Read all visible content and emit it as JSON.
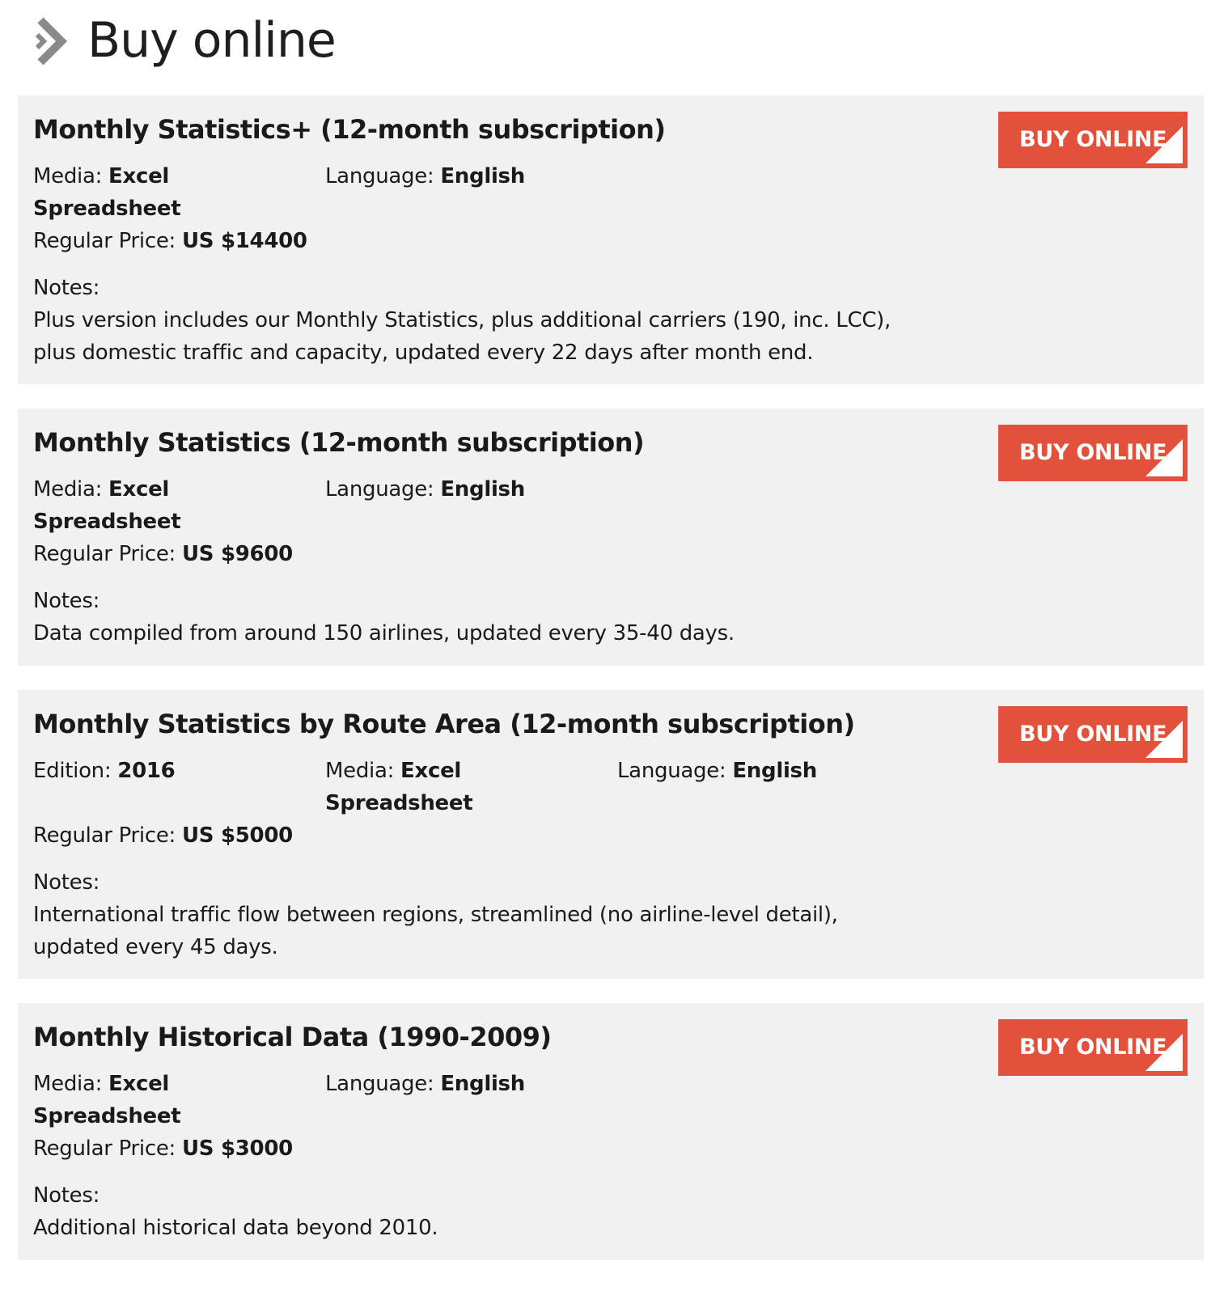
{
  "header": {
    "title": "Buy online"
  },
  "colors": {
    "accent": "#e2513b",
    "card_bg": "#f1f1f1",
    "chevron": "#8a8a8a"
  },
  "labels": {
    "edition": "Edition:",
    "media": "Media:",
    "language": "Language:",
    "regular_price": "Regular Price:",
    "notes": "Notes:",
    "buy_button": "BUY ONLINE"
  },
  "products": [
    {
      "title": "Monthly Statistics+ (12-month subscription)",
      "media": "Excel Spreadsheet",
      "language": "English",
      "price": "US $14400",
      "notes": "Plus version includes our Monthly Statistics, plus additional carriers (190, inc. LCC), plus domestic traffic and capacity, updated every 22 days after month end."
    },
    {
      "title": "Monthly Statistics (12-month subscription)",
      "media": "Excel Spreadsheet",
      "language": "English",
      "price": "US $9600",
      "notes": "Data compiled from around 150 airlines, updated every 35-40 days."
    },
    {
      "title": "Monthly Statistics by Route Area (12-month subscription)",
      "edition": "2016",
      "media": "Excel Spreadsheet",
      "language": "English",
      "price": "US $5000",
      "notes": "International traffic flow between regions, streamlined (no airline-level detail), updated every 45 days."
    },
    {
      "title": "Monthly Historical Data (1990-2009)",
      "media": "Excel Spreadsheet",
      "language": "English",
      "price": "US $3000",
      "notes": "Additional historical data beyond 2010."
    }
  ]
}
